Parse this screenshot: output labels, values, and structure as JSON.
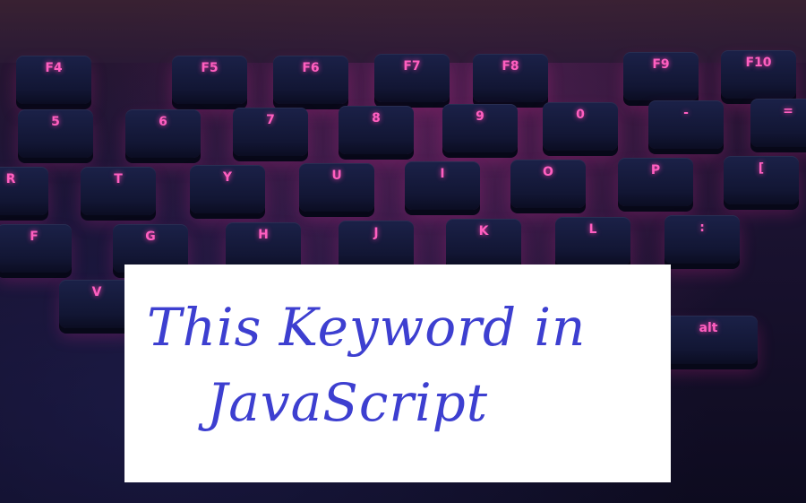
{
  "title": {
    "line1": "This Keyword in",
    "line2": "JavaScript"
  },
  "keyboard": {
    "keys": [
      {
        "label": "F4"
      },
      {
        "label": "F5"
      },
      {
        "label": "F6"
      },
      {
        "label": "F7"
      },
      {
        "label": "F8"
      },
      {
        "label": "F9"
      },
      {
        "label": "F10"
      },
      {
        "label": "5"
      },
      {
        "label": "6"
      },
      {
        "label": "7"
      },
      {
        "label": "8"
      },
      {
        "label": "9"
      },
      {
        "label": "0"
      },
      {
        "label": "-"
      },
      {
        "label": "="
      },
      {
        "label": "R"
      },
      {
        "label": "T"
      },
      {
        "label": "Y"
      },
      {
        "label": "U"
      },
      {
        "label": "I"
      },
      {
        "label": "O"
      },
      {
        "label": "P"
      },
      {
        "label": "["
      },
      {
        "label": "F"
      },
      {
        "label": "G"
      },
      {
        "label": "H"
      },
      {
        "label": "J"
      },
      {
        "label": "K"
      },
      {
        "label": "L"
      },
      {
        "label": ":"
      },
      {
        "label": "V"
      },
      {
        "label": "alt"
      }
    ]
  },
  "colors": {
    "title_text": "#3d3fd0",
    "key_glow": "#ff5fc0",
    "card_bg": "#ffffff"
  }
}
